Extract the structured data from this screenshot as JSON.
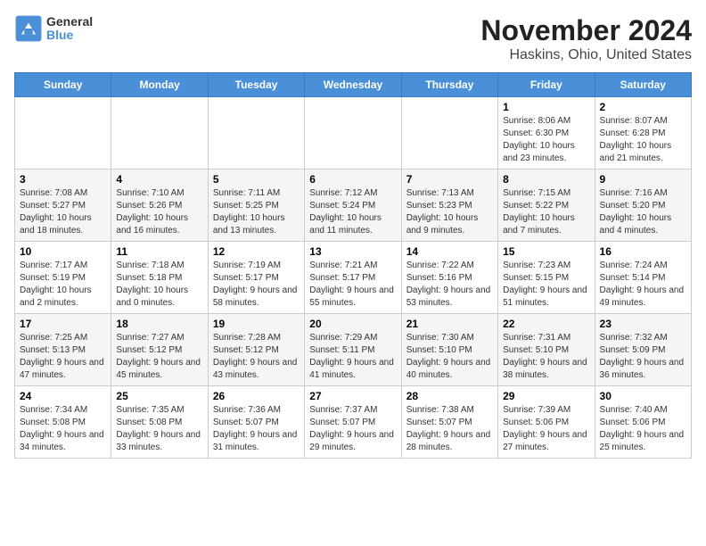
{
  "app": {
    "logo_line1": "General",
    "logo_line2": "Blue"
  },
  "title": "November 2024",
  "subtitle": "Haskins, Ohio, United States",
  "days_of_week": [
    "Sunday",
    "Monday",
    "Tuesday",
    "Wednesday",
    "Thursday",
    "Friday",
    "Saturday"
  ],
  "weeks": [
    [
      {
        "day": "",
        "info": ""
      },
      {
        "day": "",
        "info": ""
      },
      {
        "day": "",
        "info": ""
      },
      {
        "day": "",
        "info": ""
      },
      {
        "day": "",
        "info": ""
      },
      {
        "day": "1",
        "info": "Sunrise: 8:06 AM\nSunset: 6:30 PM\nDaylight: 10 hours and 23 minutes."
      },
      {
        "day": "2",
        "info": "Sunrise: 8:07 AM\nSunset: 6:28 PM\nDaylight: 10 hours and 21 minutes."
      }
    ],
    [
      {
        "day": "3",
        "info": "Sunrise: 7:08 AM\nSunset: 5:27 PM\nDaylight: 10 hours and 18 minutes."
      },
      {
        "day": "4",
        "info": "Sunrise: 7:10 AM\nSunset: 5:26 PM\nDaylight: 10 hours and 16 minutes."
      },
      {
        "day": "5",
        "info": "Sunrise: 7:11 AM\nSunset: 5:25 PM\nDaylight: 10 hours and 13 minutes."
      },
      {
        "day": "6",
        "info": "Sunrise: 7:12 AM\nSunset: 5:24 PM\nDaylight: 10 hours and 11 minutes."
      },
      {
        "day": "7",
        "info": "Sunrise: 7:13 AM\nSunset: 5:23 PM\nDaylight: 10 hours and 9 minutes."
      },
      {
        "day": "8",
        "info": "Sunrise: 7:15 AM\nSunset: 5:22 PM\nDaylight: 10 hours and 7 minutes."
      },
      {
        "day": "9",
        "info": "Sunrise: 7:16 AM\nSunset: 5:20 PM\nDaylight: 10 hours and 4 minutes."
      }
    ],
    [
      {
        "day": "10",
        "info": "Sunrise: 7:17 AM\nSunset: 5:19 PM\nDaylight: 10 hours and 2 minutes."
      },
      {
        "day": "11",
        "info": "Sunrise: 7:18 AM\nSunset: 5:18 PM\nDaylight: 10 hours and 0 minutes."
      },
      {
        "day": "12",
        "info": "Sunrise: 7:19 AM\nSunset: 5:17 PM\nDaylight: 9 hours and 58 minutes."
      },
      {
        "day": "13",
        "info": "Sunrise: 7:21 AM\nSunset: 5:17 PM\nDaylight: 9 hours and 55 minutes."
      },
      {
        "day": "14",
        "info": "Sunrise: 7:22 AM\nSunset: 5:16 PM\nDaylight: 9 hours and 53 minutes."
      },
      {
        "day": "15",
        "info": "Sunrise: 7:23 AM\nSunset: 5:15 PM\nDaylight: 9 hours and 51 minutes."
      },
      {
        "day": "16",
        "info": "Sunrise: 7:24 AM\nSunset: 5:14 PM\nDaylight: 9 hours and 49 minutes."
      }
    ],
    [
      {
        "day": "17",
        "info": "Sunrise: 7:25 AM\nSunset: 5:13 PM\nDaylight: 9 hours and 47 minutes."
      },
      {
        "day": "18",
        "info": "Sunrise: 7:27 AM\nSunset: 5:12 PM\nDaylight: 9 hours and 45 minutes."
      },
      {
        "day": "19",
        "info": "Sunrise: 7:28 AM\nSunset: 5:12 PM\nDaylight: 9 hours and 43 minutes."
      },
      {
        "day": "20",
        "info": "Sunrise: 7:29 AM\nSunset: 5:11 PM\nDaylight: 9 hours and 41 minutes."
      },
      {
        "day": "21",
        "info": "Sunrise: 7:30 AM\nSunset: 5:10 PM\nDaylight: 9 hours and 40 minutes."
      },
      {
        "day": "22",
        "info": "Sunrise: 7:31 AM\nSunset: 5:10 PM\nDaylight: 9 hours and 38 minutes."
      },
      {
        "day": "23",
        "info": "Sunrise: 7:32 AM\nSunset: 5:09 PM\nDaylight: 9 hours and 36 minutes."
      }
    ],
    [
      {
        "day": "24",
        "info": "Sunrise: 7:34 AM\nSunset: 5:08 PM\nDaylight: 9 hours and 34 minutes."
      },
      {
        "day": "25",
        "info": "Sunrise: 7:35 AM\nSunset: 5:08 PM\nDaylight: 9 hours and 33 minutes."
      },
      {
        "day": "26",
        "info": "Sunrise: 7:36 AM\nSunset: 5:07 PM\nDaylight: 9 hours and 31 minutes."
      },
      {
        "day": "27",
        "info": "Sunrise: 7:37 AM\nSunset: 5:07 PM\nDaylight: 9 hours and 29 minutes."
      },
      {
        "day": "28",
        "info": "Sunrise: 7:38 AM\nSunset: 5:07 PM\nDaylight: 9 hours and 28 minutes."
      },
      {
        "day": "29",
        "info": "Sunrise: 7:39 AM\nSunset: 5:06 PM\nDaylight: 9 hours and 27 minutes."
      },
      {
        "day": "30",
        "info": "Sunrise: 7:40 AM\nSunset: 5:06 PM\nDaylight: 9 hours and 25 minutes."
      }
    ]
  ]
}
